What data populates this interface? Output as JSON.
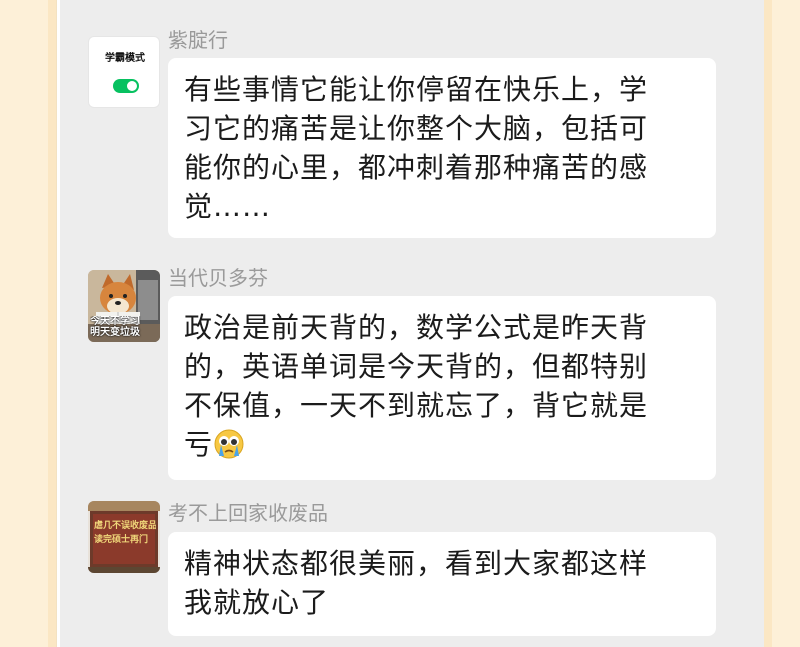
{
  "colors": {
    "chat_background": "#ededed",
    "bubble_background": "#ffffff",
    "side_panel": "#fdf0d8",
    "toggle_on": "#07c160",
    "sender_name": "#9a9a9a"
  },
  "messages": [
    {
      "sender": "紫腚行",
      "avatar": {
        "type": "toggle-card",
        "label": "学霸模式",
        "toggle_on": true
      },
      "lines": [
        "有些事情它能让你停留在快乐上，学",
        "习它的痛苦是让你整个大脑，包括可",
        "能你的心里，都冲刺着那种痛苦的感",
        "觉……"
      ]
    },
    {
      "sender": "当代贝多芬",
      "avatar": {
        "type": "photo",
        "depicts": "shiba-dog-reading",
        "caption_lines": [
          "今天不学习",
          "明天变垃圾"
        ]
      },
      "lines": [
        "政治是前天背的，数学公式是昨天背",
        "的，英语单词是今天背的，但都特别",
        "不保值，一天不到就忘了，背它就是",
        "亏"
      ],
      "trailing_emoji": "crying-face-emoji"
    },
    {
      "sender": "考不上回家收废品",
      "avatar": {
        "type": "photo",
        "depicts": "red-plaque-with-gold-text",
        "plaque_lines": [
          "虐几不误收废品",
          "读完硕士再门"
        ]
      },
      "lines": [
        "精神状态都很美丽，看到大家都这样",
        "我就放心了"
      ]
    }
  ]
}
